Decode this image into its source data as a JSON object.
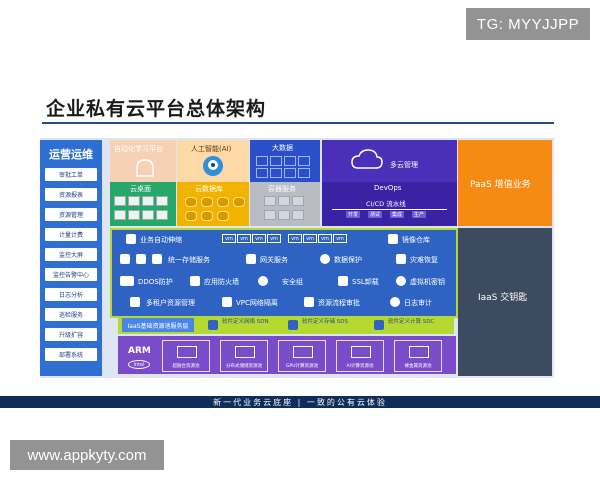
{
  "watermark_top": "TG: MYYJJPP",
  "watermark_bottom": "www.appkyty.com",
  "title": "企业私有云平台总体架构",
  "ops": {
    "title": "运营运维",
    "items": [
      "审批工单",
      "资源报表",
      "资源管理",
      "计量计费",
      "监控大屏",
      "监控告警中心",
      "日志分析",
      "巡检服务",
      "升级扩容",
      "部署系统"
    ]
  },
  "top_tiles": {
    "auto_learning": "自动化学习平台",
    "ai": "人工智能(AI)",
    "big_data": "大数据",
    "multi_cloud": "多云管理",
    "cloud_desktop": "云桌面",
    "cloud_db": "云数据库",
    "container": "容器服务",
    "devops": "DevOps",
    "cicd": "CI/CD 流水线",
    "pipeline": [
      "开发",
      "测试",
      "集成",
      "生产"
    ],
    "paas": "PaaS 增值业务"
  },
  "iaas_features": {
    "autoscale": "业务自动伸缩",
    "vm": "vm",
    "image_repo": "镜像仓库",
    "unified_storage": "统一存储服务",
    "network_service": "网关服务",
    "data_protection": "数据保护",
    "disaster_recovery": "灾难恢复",
    "ddos": "DDOS防护",
    "app_firewall": "应用防火墙",
    "security_group": "安全组",
    "ssl_offload": "SSL卸载",
    "vm_key": "虚拟机密钥",
    "multi_tenant": "多租户资源管理",
    "vpc": "VPC网络隔离",
    "workflow_approval": "资源流程审批",
    "log_audit": "日志审计"
  },
  "iaas_base": "IaaS基础资源池服务层",
  "sdx": [
    "软件定义网络 SDN",
    "软件定义存储 SDS",
    "软件定义计算 SDC"
  ],
  "hardware": {
    "arm": "ARM",
    "intel": "intel",
    "items": [
      "超融合资源池",
      "分布式储储资源池",
      "GPU计算资源池",
      "AI计算资源池",
      "裸金属资源池"
    ]
  },
  "iaas_key": "IaaS 交钥匙",
  "footer": "新一代业务云底座    |    一致的公有云体验",
  "colors": {
    "ops_blue": "#2f6fd1",
    "paas_orange": "#f58b12",
    "iaas_blue": "#2e63c4",
    "accent_green": "#b6d931",
    "hardware_purple": "#7b4cc9",
    "dark_panel": "#3d4b60",
    "footer_navy": "#102c5a"
  }
}
